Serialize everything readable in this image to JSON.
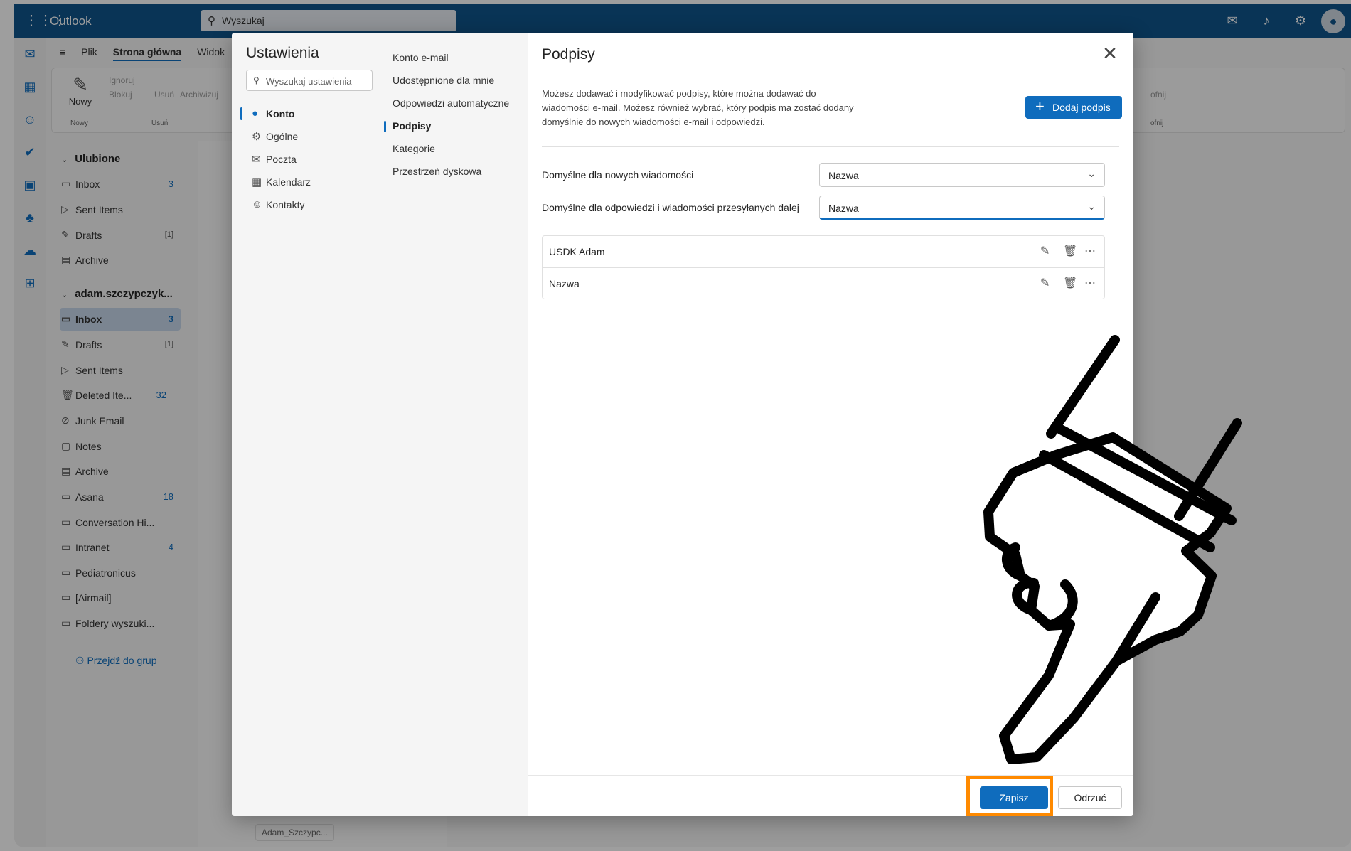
{
  "topbar": {
    "app_name": "Outlook",
    "search_placeholder": "Wyszukaj"
  },
  "ribbon": {
    "tabs": [
      "Plik",
      "Strona główna",
      "Widok"
    ],
    "new_label": "Nowy",
    "ignore_label": "Ignoruj",
    "block_label": "Blokuj",
    "delete_label": "Usuń",
    "archive_label": "Archiwizuj",
    "group_new": "Nowy",
    "group_delete": "Usuń",
    "undo_label": "ofnij",
    "undo_group": "ofnij"
  },
  "folders": {
    "favorites_title": "Ulubione",
    "favorites": [
      {
        "label": "Inbox",
        "count": "3"
      },
      {
        "label": "Sent Items",
        "count": ""
      },
      {
        "label": "Drafts",
        "count": "[1]"
      },
      {
        "label": "Archive",
        "count": ""
      }
    ],
    "account_title": "adam.szczypczyk...",
    "account_folders": [
      {
        "label": "Inbox",
        "count": "3"
      },
      {
        "label": "Drafts",
        "count": "[1]"
      },
      {
        "label": "Sent Items",
        "count": ""
      },
      {
        "label": "Deleted Ite...",
        "count": "32"
      },
      {
        "label": "Junk Email",
        "count": ""
      },
      {
        "label": "Notes",
        "count": ""
      },
      {
        "label": "Archive",
        "count": ""
      },
      {
        "label": "Asana",
        "count": "18"
      },
      {
        "label": "Conversation Hi...",
        "count": ""
      },
      {
        "label": "Intranet",
        "count": "4"
      },
      {
        "label": "Pediatronicus",
        "count": ""
      },
      {
        "label": "[Airmail]",
        "count": ""
      },
      {
        "label": "Foldery wyszuki...",
        "count": ""
      }
    ],
    "groups_link": "Przejdź do grup"
  },
  "msglist": {
    "attachment": "Adam_Szczypc..."
  },
  "settings": {
    "title": "Ustawienia",
    "search_placeholder": "Wyszukaj ustawienia",
    "categories": [
      {
        "label": "Konto",
        "active": true
      },
      {
        "label": "Ogólne",
        "active": false
      },
      {
        "label": "Poczta",
        "active": false
      },
      {
        "label": "Kalendarz",
        "active": false
      },
      {
        "label": "Kontakty",
        "active": false
      }
    ],
    "subcategories": [
      {
        "label": "Konto e-mail",
        "active": false
      },
      {
        "label": "Udostępnione dla mnie",
        "active": false
      },
      {
        "label": "Odpowiedzi automatyczne",
        "active": false
      },
      {
        "label": "Podpisy",
        "active": true
      },
      {
        "label": "Kategorie",
        "active": false
      },
      {
        "label": "Przestrzeń dyskowa",
        "active": false
      }
    ]
  },
  "signatures": {
    "title": "Podpisy",
    "description": "Możesz dodawać i modyfikować podpisy, które można dodawać do wiadomości e-mail. Możesz również wybrać, który podpis ma zostać dodany domyślnie do nowych wiadomości e-mail i odpowiedzi.",
    "add_button": "Dodaj podpis",
    "default_new_label": "Domyślne dla nowych wiadomości",
    "default_new_value": "Nazwa",
    "default_reply_label": "Domyślne dla odpowiedzi i wiadomości przesyłanych dalej",
    "default_reply_value": "Nazwa",
    "list": [
      {
        "name": "USDK Adam"
      },
      {
        "name": "Nazwa"
      }
    ],
    "save_button": "Zapisz",
    "discard_button": "Odrzuć"
  },
  "colors": {
    "brand": "#0f548c",
    "accent": "#0f6cbd",
    "highlight": "#ff8a00"
  }
}
